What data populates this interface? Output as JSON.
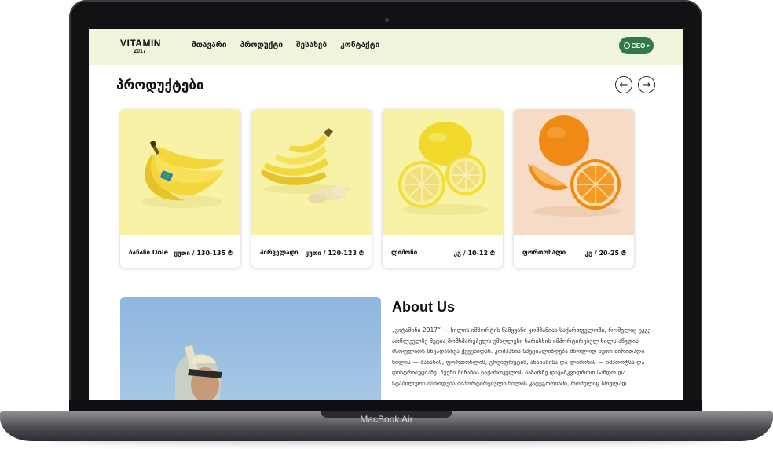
{
  "device": {
    "label": "MacBook Air"
  },
  "nav": {
    "logo_main": "VITAMIN",
    "logo_year": "2017",
    "items": [
      "მთავარი",
      "პროდუქტი",
      "შესახებ",
      "კონტაქტი"
    ],
    "language": "GEO"
  },
  "products_section": {
    "title": "პროდუქტები",
    "items": [
      {
        "name": "ბანანი Dole",
        "price": "ყუთი / 130-135 ₾",
        "bg": "#f7f2a5"
      },
      {
        "name": "პირველადი",
        "price": "ყუთი / 120-123 ₾",
        "bg": "#f7f2a5"
      },
      {
        "name": "ლიმონი",
        "price": "კგ / 10-12 ₾",
        "bg": "#f7f2a5"
      },
      {
        "name": "ფორთოხალი",
        "price": "კგ / 20-25 ₾",
        "bg": "#f6dcc6"
      }
    ]
  },
  "about": {
    "title": "About Us",
    "text": "„ვიტამინი 2017“ — ხილის იმპორტის წამყვანი კომპანიაა საქართველოში, რომელიც უკვე ათწლეულზე მეტია მომხმარებელს უმაღლესი ხარისხის იმპორტირებულ ხილს აწვდის მსოფლიოს სხვადასხვა ქვეყნიდან. კომპანია სპეციალიზდება მხოლოდ ხუთი ძირითადი ხილის — ბანანის, ფორთოხლის, გრეიფრუტის, ანანასისა და ლიმონის — იმპორტსა და დისტრიბუციაზე. ჩვენი მიზანია საქართველოს ბაზარზე დავამკვიდროთ სანდო და სტაბილური მიწოდება იმპორტირებული ხილის კატეგორიაში, რომელიც სრულად"
  },
  "colors": {
    "nav_bg": "#eef5dc",
    "accent": "#2f7a45"
  }
}
